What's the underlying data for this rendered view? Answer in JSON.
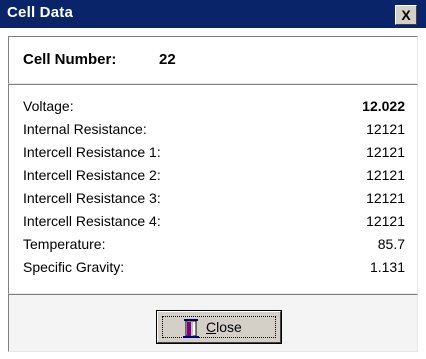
{
  "window": {
    "title": "Cell Data",
    "close_glyph": "X"
  },
  "header": {
    "label": "Cell Number:",
    "value": "22"
  },
  "rows": [
    {
      "label": "Voltage:",
      "value": "12.022"
    },
    {
      "label": "Internal Resistance:",
      "value": "12121"
    },
    {
      "label": "Intercell Resistance 1:",
      "value": "12121"
    },
    {
      "label": "Intercell Resistance 2:",
      "value": "12121"
    },
    {
      "label": "Intercell Resistance 3:",
      "value": "12121"
    },
    {
      "label": "Intercell Resistance 4:",
      "value": "12121"
    },
    {
      "label": "Temperature:",
      "value": "85.7"
    },
    {
      "label": "Specific Gravity:",
      "value": "1.131"
    }
  ],
  "footer": {
    "close_button": {
      "label": "Close",
      "icon": "door-icon"
    }
  },
  "colors": {
    "titlebar": "#0a246a",
    "button_face": "#d4d0c8"
  }
}
